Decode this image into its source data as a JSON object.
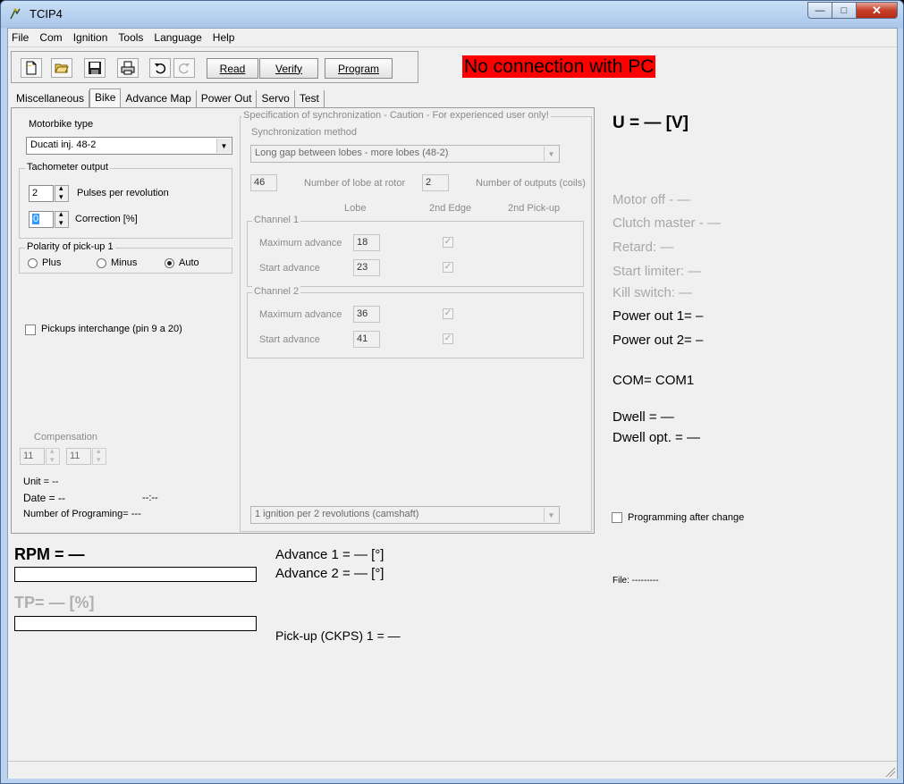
{
  "window": {
    "title": "TCIP4"
  },
  "menu": [
    "File",
    "Com",
    "Ignition",
    "Tools",
    "Language",
    "Help"
  ],
  "toolbar": {
    "read": "Read",
    "verify": "Verify",
    "program": "Program"
  },
  "status_banner": "No connection with PC",
  "tabs": [
    "Miscellaneous",
    "Bike",
    "Advance Map",
    "Power Out",
    "Servo",
    "Test"
  ],
  "bike": {
    "motorbike_type_label": "Motorbike type",
    "motorbike_type": "Ducati inj. 48-2",
    "tachometer_label": "Tachometer output",
    "pulses_value": "2",
    "pulses_label": "Pulses per revolution",
    "correction_value": "0",
    "correction_label": "Correction [%]",
    "polarity_label": "Polarity of pick-up 1",
    "polarity_options": [
      "Plus",
      "Minus",
      "Auto"
    ],
    "pickups_interchange": "Pickups interchange (pin 9 a 20)",
    "compensation_label": "Compensation",
    "comp_a": "11",
    "comp_b": "11",
    "unit": "Unit = --",
    "date": "Date = --",
    "date_time": "--:--",
    "num_programing": "Number of Programing= ---"
  },
  "sync": {
    "group_label": "Specification of synchronization - Caution - For experienced user only!",
    "method_label": "Synchronization method",
    "method_value": "Long gap between lobes - more lobes (48-2)",
    "lobes_value": "46",
    "lobes_label": "Number of lobe at rotor",
    "outputs_value": "2",
    "outputs_label": "Number of outputs (coils)",
    "col_lobe": "Lobe",
    "col_edge": "2nd Edge",
    "col_pickup": "2nd Pick-up",
    "channel1": {
      "label": "Channel 1",
      "max_label": "Maximum advance",
      "max_value": "18",
      "start_label": "Start advance",
      "start_value": "23"
    },
    "channel2": {
      "label": "Channel 2",
      "max_label": "Maximum advance",
      "max_value": "36",
      "start_label": "Start advance",
      "start_value": "41"
    },
    "ignition_value": "1 ignition per 2 revolutions (camshaft)"
  },
  "right": {
    "voltage": "U = — [V]",
    "motor_off": "Motor off - —",
    "clutch_master": "Clutch master - —",
    "retard": "Retard: —",
    "start_limiter": "Start limiter: —",
    "kill_switch": "Kill switch: —",
    "power_out1": "Power out 1= –",
    "power_out2": "Power out 2= –",
    "com": "COM= COM1",
    "dwell": "Dwell = —",
    "dwell_opt": "Dwell opt. = —",
    "prog_after_change": "Programming after change",
    "file": "File:  ---------"
  },
  "bottom": {
    "rpm": "RPM = —",
    "tp": "TP= — [%]",
    "advance1": "Advance 1 = — [°]",
    "advance2": "Advance 2 = — [°]",
    "pickup": "Pick-up (CKPS) 1 = —"
  },
  "icons": [
    "app-icon",
    "new-file-icon",
    "open-folder-icon",
    "save-icon",
    "print-icon",
    "undo-icon",
    "redo-icon"
  ]
}
